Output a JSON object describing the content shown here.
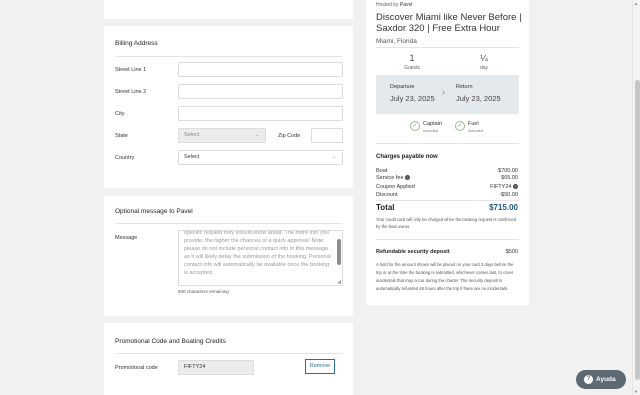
{
  "billing": {
    "title": "Billing Address",
    "street1_label": "Street Line 1",
    "street2_label": "Street Line 2",
    "city_label": "City",
    "state_label": "State",
    "state_value": "Select",
    "zip_label": "Zip Code",
    "country_label": "Country",
    "country_value": "Select"
  },
  "message": {
    "title": "Optional message to Pavel",
    "label": "Message",
    "text": "specific request they should know about. The more info you provide, the higher the chances of a quick approval! Note: please do not include personal contact info in this message as it will likely delay the submission of the booking. Personal contact info will automatically be available once the booking is accepted.",
    "counter": "500 characters remaining"
  },
  "promo": {
    "title": "Promotional Code and Boating Credits",
    "label": "Promotional code",
    "value": "FIFTY24",
    "remove_label": "Remove"
  },
  "listing": {
    "hosted_prefix": "Hosted by",
    "host": "Pavel",
    "title": "Discover Miami like Never Before | Saxdor 320 | Free Extra Hour",
    "location": "Miami, Florida",
    "guests_value": "1",
    "guests_label": "Guests",
    "duration_value": "¼",
    "duration_label": "day",
    "departure_label": "Departure",
    "departure_date": "July 23, 2025",
    "return_label": "Return",
    "return_date": "July 23, 2025",
    "captain_label": "Captain",
    "captain_sub": "Included",
    "fuel_label": "Fuel",
    "fuel_sub": "Included"
  },
  "charges": {
    "title": "Charges payable now",
    "rows": [
      {
        "label": "Boat",
        "value": "$700.00"
      },
      {
        "label": "Service fee",
        "value": "$65.00"
      },
      {
        "label": "Coupon Applied",
        "value": "FIFTY24"
      },
      {
        "label": "Discount",
        "value": "-$50.00"
      }
    ],
    "total_label": "Total",
    "total_value": "$715.00",
    "note": "Your credit card will only be charged when the booking request is confirmed by the boat owner."
  },
  "security": {
    "title": "Refundable security deposit",
    "value": "$500",
    "note": "A hold for the amount shown will be placed on your card 3 days before the trip or at the time the booking is submitted, whichever comes last, to cover incidentals that may occur during the charter. The security deposit is automatically refunded 48 hours after the trip if there are no incidentals."
  },
  "help": {
    "label": "Ayuda"
  },
  "colors": {
    "accent": "#2a6f97",
    "total": "#1f5a82",
    "dates_bg": "#e3e9ec",
    "check_green": "#7aa86a"
  }
}
